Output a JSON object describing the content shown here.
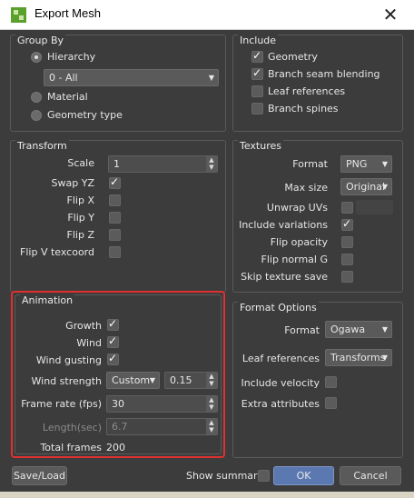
{
  "window": {
    "title": "Export Mesh",
    "close_glyph": "✕"
  },
  "group_by": {
    "title": "Group By",
    "hierarchy_label": "Hierarchy",
    "hierarchy_value": "0 - All",
    "material_label": "Material",
    "geometry_type_label": "Geometry type",
    "selected": "Hierarchy"
  },
  "include": {
    "title": "Include",
    "items": [
      {
        "label": "Geometry",
        "checked": true
      },
      {
        "label": "Branch seam blending",
        "checked": true
      },
      {
        "label": "Leaf references",
        "checked": false
      },
      {
        "label": "Branch spines",
        "checked": false
      }
    ]
  },
  "transform": {
    "title": "Transform",
    "scale_label": "Scale",
    "scale_value": "1",
    "swap_yz_label": "Swap YZ",
    "swap_yz": true,
    "flip_x_label": "Flip X",
    "flip_y_label": "Flip Y",
    "flip_z_label": "Flip Z",
    "flip_v_label": "Flip V texcoord"
  },
  "textures": {
    "title": "Textures",
    "format_label": "Format",
    "format_value": "PNG",
    "max_size_label": "Max size",
    "max_size_value": "Original",
    "unwrap_label": "Unwrap UVs",
    "include_variations_label": "Include variations",
    "include_variations": true,
    "flip_opacity_label": "Flip opacity",
    "flip_normal_label": "Flip normal G",
    "skip_texture_label": "Skip texture save"
  },
  "animation": {
    "title": "Animation",
    "growth_label": "Growth",
    "growth": true,
    "wind_label": "Wind",
    "wind": true,
    "wind_gusting_label": "Wind gusting",
    "wind_gusting": true,
    "wind_strength_label": "Wind strength",
    "wind_strength_mode": "Custom",
    "wind_strength_value": "0.15",
    "frame_rate_label": "Frame rate (fps)",
    "frame_rate_value": "30",
    "length_label": "Length(sec)",
    "length_value": "6.7",
    "total_frames_label": "Total frames",
    "total_frames_value": "200"
  },
  "format_options": {
    "title": "Format Options",
    "format_label": "Format",
    "format_value": "Ogawa",
    "leaf_refs_label": "Leaf references",
    "leaf_refs_value": "Transforms",
    "include_velocity_label": "Include velocity",
    "extra_attributes_label": "Extra attributes"
  },
  "footer": {
    "save_load_label": "Save/Load",
    "show_summary_label": "Show summary",
    "ok_label": "OK",
    "cancel_label": "Cancel"
  },
  "colors": {
    "accent": "#5b79b0",
    "highlight": "#e03030",
    "background": "#3c3c3c"
  }
}
